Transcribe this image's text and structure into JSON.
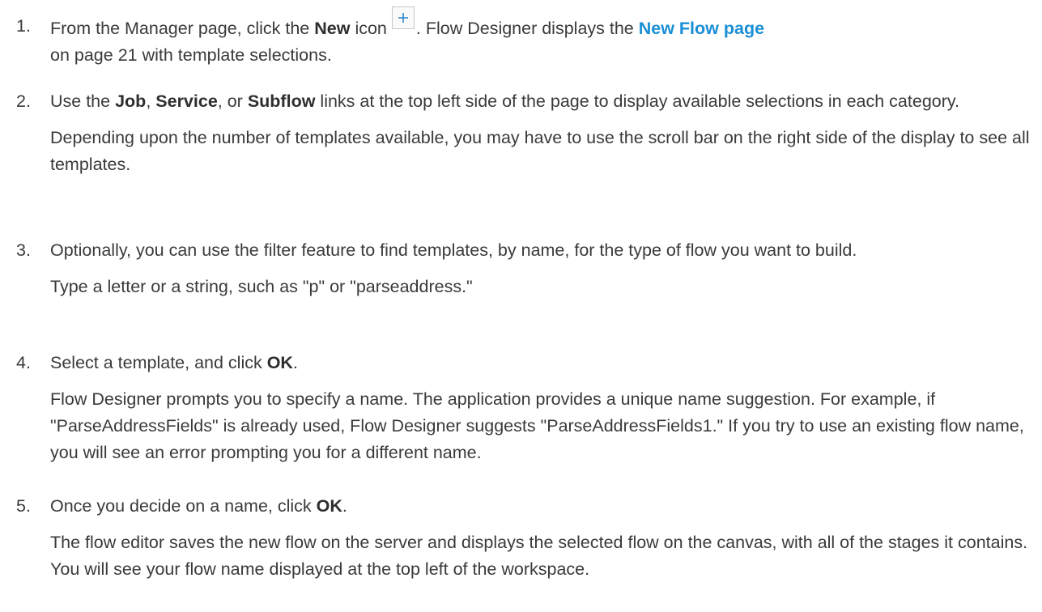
{
  "steps": [
    {
      "number": "1.",
      "line1_a": "From the Manager page, click the ",
      "new_bold": "New",
      "line1_b": " icon",
      "line1_c": ". Flow Designer displays the ",
      "link_text": "New Flow page",
      "line2": "on page 21 with template selections."
    },
    {
      "number": "2.",
      "a": "Use the ",
      "job": "Job",
      "comma1": ", ",
      "service": "Service",
      "or": ", or ",
      "subflow": "Subflow",
      "b": " links at the top left side of the page to display available selections in each category.",
      "para2": "Depending upon the number of templates available, you may have to use the scroll bar on the right side of the display to see all templates."
    },
    {
      "number": "3.",
      "para1": "Optionally, you can use the filter feature to find templates, by name, for the type of flow you want to build.",
      "para2": "Type a letter or a string, such as \"p\" or \"parseaddress.\""
    },
    {
      "number": "4.",
      "a": "Select a template, and click ",
      "ok": "OK",
      "b": ".",
      "para2": "Flow Designer prompts you to specify a name. The application provides a unique name suggestion. For example, if \"ParseAddressFields\" is already used, Flow Designer suggests \"ParseAddressFields1.\" If you try to use an existing flow name, you will see an error prompting you for a different name."
    },
    {
      "number": "5.",
      "a": "Once you decide on a name, click ",
      "ok": "OK",
      "b": ".",
      "para2": "The flow editor saves the new flow on the server and displays the selected flow on the canvas, with all of the stages it contains. You will see your flow name displayed at the top left of the workspace."
    }
  ],
  "colors": {
    "text": "#3a3a3a",
    "link": "#1a8fd6"
  },
  "icons": [
    "plus-icon"
  ]
}
